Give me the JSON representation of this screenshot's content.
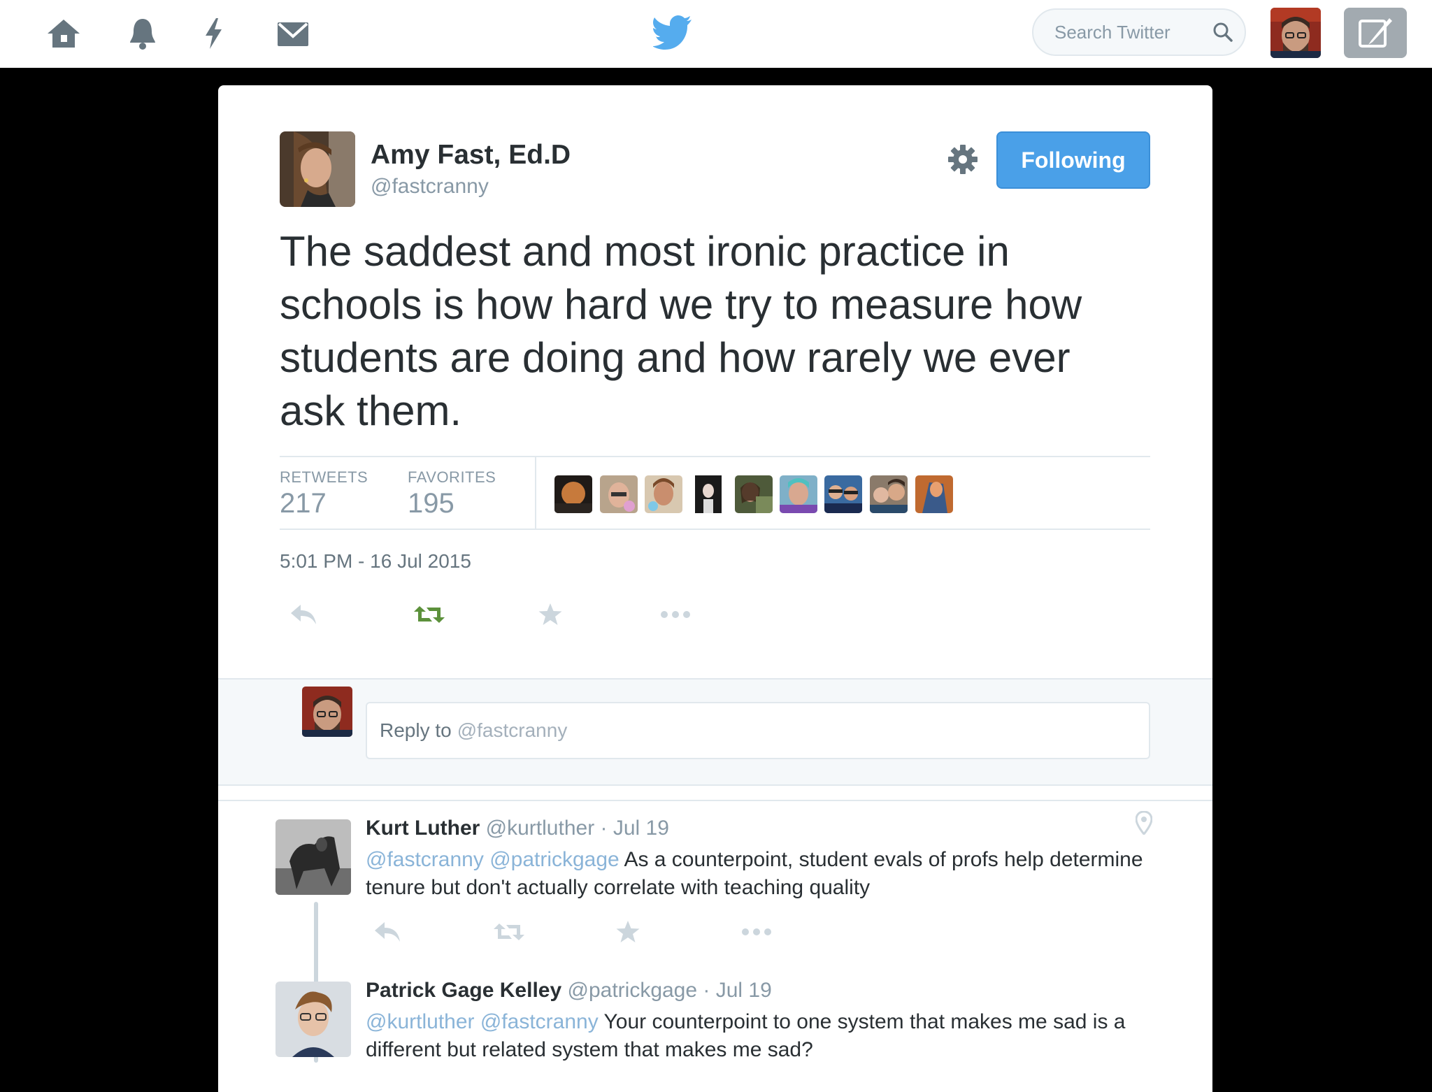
{
  "nav": {
    "icons": [
      "home-icon",
      "notifications-icon",
      "discover-icon",
      "messages-icon"
    ],
    "logo": "twitter-bird-icon",
    "search_placeholder": "Search Twitter",
    "compose_icon": "compose-tweet-icon"
  },
  "tweet": {
    "author_name": "Amy Fast, Ed.D",
    "author_handle": "@fastcranny",
    "follow_label": "Following",
    "text": "The saddest and most ironic practice in schools is how hard we try to measure how students are doing and how rarely we ever ask them.",
    "retweets_label": "RETWEETS",
    "retweets": "217",
    "favorites_label": "FAVORITES",
    "favorites": "195",
    "timestamp": "5:01 PM - 16 Jul 2015",
    "actions": [
      "reply-icon",
      "retweet-icon",
      "favorite-icon",
      "more-icon"
    ]
  },
  "reply_box": {
    "prefix": "Reply to",
    "handle": "@fastcranny"
  },
  "replies": [
    {
      "name": "Kurt Luther",
      "handle_date": "@kurtluther · Jul 19",
      "mentions": "@fastcranny @patrickgage",
      "text": "As a counterpoint, student evals of profs help determine tenure but don't actually correlate with teaching quality"
    },
    {
      "name": "Patrick Gage Kelley",
      "handle_date": "@patrickgage · Jul 19",
      "mentions": "@kurtluther @fastcranny",
      "text": "Your counterpoint to one system that makes me sad is a different but related system that makes me sad?"
    }
  ],
  "colors": {
    "brand_blue": "#55acee",
    "following_blue": "#4aa0e8",
    "retweet_green": "#19cf86",
    "muted": "#8899a6"
  }
}
